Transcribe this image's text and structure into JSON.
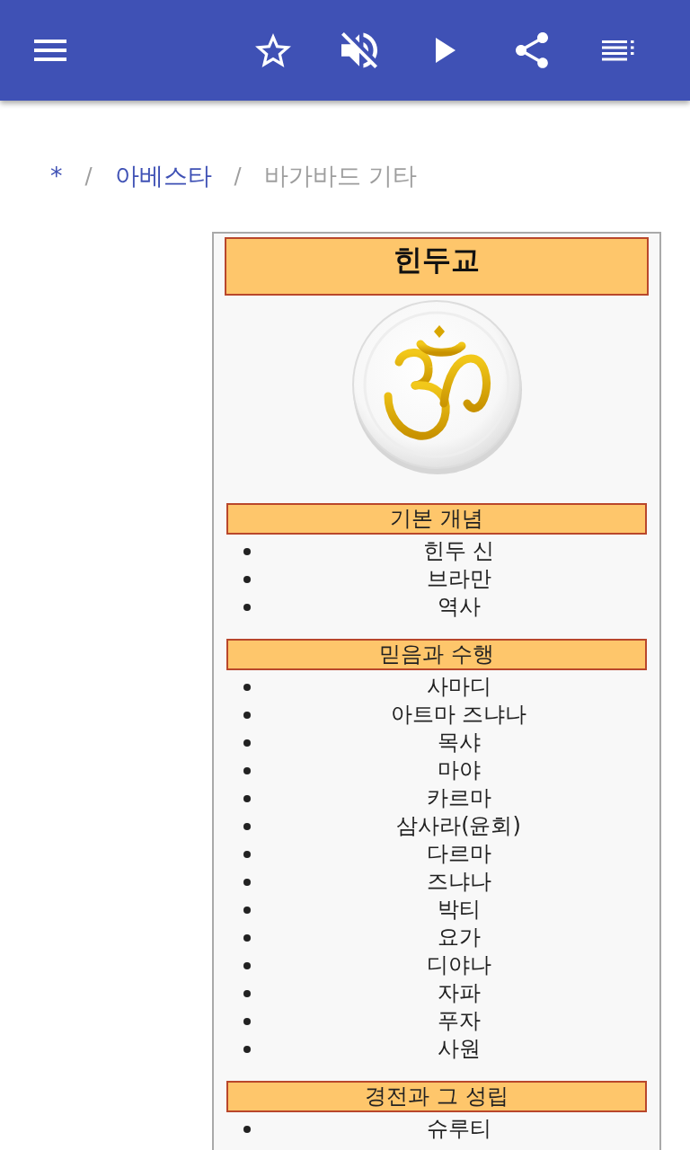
{
  "app_bar": {
    "favorite": false,
    "muted": true,
    "playing": false
  },
  "breadcrumb": [
    {
      "label": "*",
      "current": false
    },
    {
      "separator": "/",
      "label": "아베스타",
      "current": false
    },
    {
      "separator": "/",
      "label": "바가바드 기타",
      "current": true
    }
  ],
  "infobox": {
    "title": "힌두교",
    "sections": [
      {
        "heading": "기본 개념",
        "items": [
          "힌두 신",
          "브라만",
          "역사"
        ]
      },
      {
        "heading": "믿음과 수행",
        "items": [
          "사마디",
          "아트마 즈냐나",
          "목샤",
          "마야",
          "카르마",
          "삼사라(윤회)",
          "다르마",
          "즈냐나",
          "박티",
          "요가",
          "디야나",
          "자파",
          "푸자",
          "사원"
        ]
      },
      {
        "heading": "경전과 그 성립",
        "items": [
          "슈루티"
        ]
      }
    ]
  }
}
